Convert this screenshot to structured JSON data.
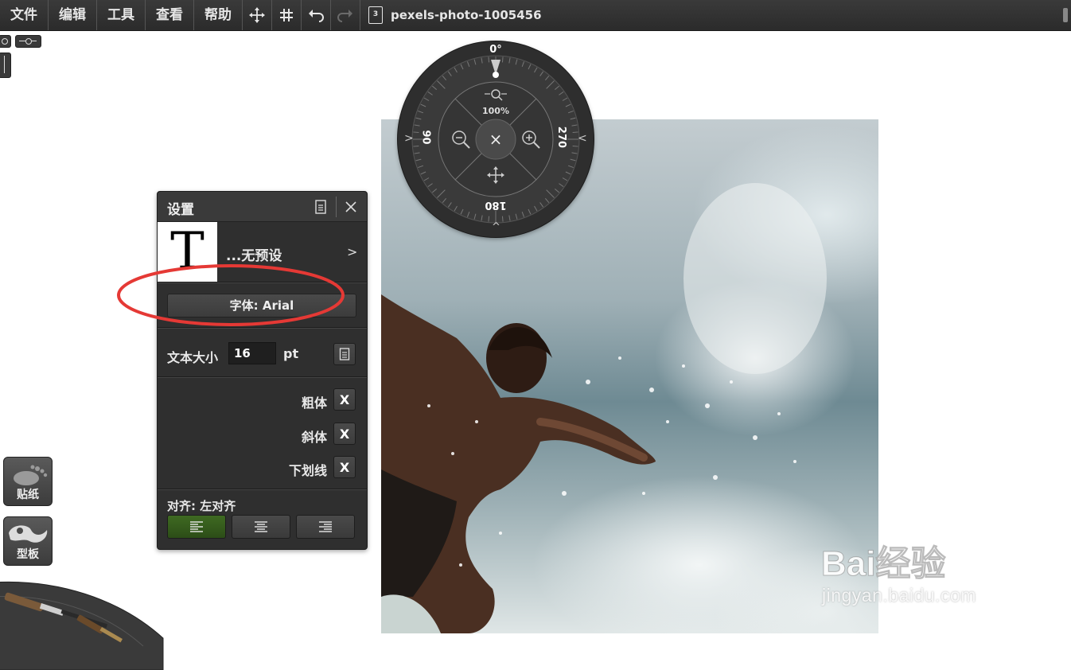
{
  "menubar": {
    "menus": [
      "文件",
      "编辑",
      "工具",
      "查看",
      "帮助"
    ],
    "document_title": "pexels-photo-1005456",
    "document_badge": "3"
  },
  "compass": {
    "top_angle": "0°",
    "left_angle": "90",
    "right_angle": "270",
    "bottom_angle": "180",
    "zoom": "100%"
  },
  "settings_panel": {
    "title": "设置",
    "preview_letter": "T",
    "preset_label": "...无预设",
    "preset_arrow": ">",
    "font_button": "字体: Arial",
    "text_size_label": "文本大小",
    "text_size_value": "16",
    "text_size_unit": "pt",
    "options": [
      {
        "label": "粗体",
        "value": "X"
      },
      {
        "label": "斜体",
        "value": "X"
      },
      {
        "label": "下划线",
        "value": "X"
      }
    ],
    "align_label": "对齐: 左对齐",
    "align_options": [
      "left",
      "center",
      "right"
    ],
    "align_selected": "left"
  },
  "side_tools": {
    "sticker_label": "贴纸",
    "template_label": "型板"
  },
  "watermark": {
    "brand": "Bai经验",
    "domain": "jingyan.baidu.com"
  },
  "colors": {
    "panel_bg": "#2f2f2f",
    "active_align": "#3f6a22",
    "annotation": "#e53935"
  }
}
